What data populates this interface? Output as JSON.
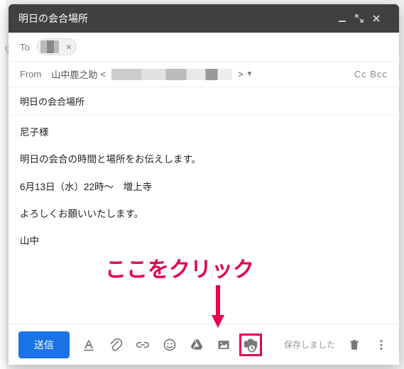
{
  "header": {
    "title": "明日の会合場所"
  },
  "to": {
    "label": "To"
  },
  "from": {
    "label": "From",
    "name": "山中鹿之助",
    "open_bracket": "<",
    "close_bracket": ">"
  },
  "ccbcc": {
    "cc": "Cc",
    "bcc": "Bcc"
  },
  "subject": "明日の会合場所",
  "body": {
    "p1": "尼子様",
    "p2": "明日の会合の時間と場所をお伝えします。",
    "p3": "6月13日（水）22時～　増上寺",
    "p4": "よろしくお願いいたします。",
    "p5": "山中"
  },
  "toolbar": {
    "send": "送信",
    "saved": "保存しました"
  },
  "callout": {
    "text": "ここをクリック"
  }
}
